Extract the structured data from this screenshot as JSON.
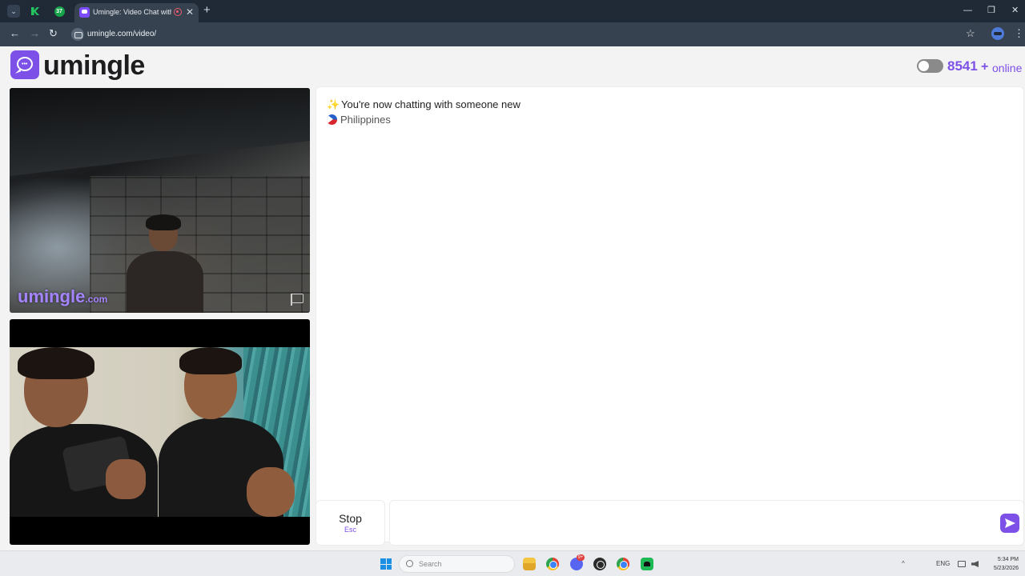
{
  "browser": {
    "tab_title": "Umingle: Video Chat with S",
    "close_glyph": "✕",
    "new_tab_glyph": "+",
    "pinned_tab_2_badge": "37",
    "url": "umingle.com/video/",
    "back_glyph": "←",
    "forward_glyph": "→",
    "reload_glyph": "↻",
    "star_glyph": "☆",
    "menu_glyph": "⋮",
    "minimize_glyph": "—",
    "maximize_glyph": "❐",
    "window_close_glyph": "✕",
    "tab_menu_glyph": "⌄"
  },
  "header": {
    "logo_text": "umingle",
    "logo_dots": "•••",
    "online_count": "8541",
    "online_plus": "+",
    "online_label": "online",
    "toggle_on": false
  },
  "video": {
    "watermark_main": "umingle",
    "watermark_suffix": ".com"
  },
  "chat": {
    "sparkle_glyph": "✨",
    "status_message": "You're now chatting with someone new",
    "country": "Philippines",
    "input_value": "",
    "input_placeholder": ""
  },
  "controls": {
    "stop_label": "Stop",
    "stop_key": "Esc"
  },
  "taskbar": {
    "search_text": "Search",
    "discord_badge": "9+",
    "tray_chevron": "^",
    "lang": "ENG",
    "time": "5:34 PM",
    "date": "5/23/2026"
  },
  "colors": {
    "brand": "#7d50e8",
    "tab_bar": "#1f2a36",
    "toolbar": "#36424f",
    "page_bg": "#f3f3f3"
  }
}
